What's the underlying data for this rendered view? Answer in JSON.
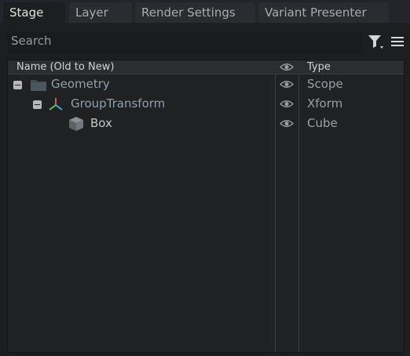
{
  "tabs": [
    {
      "label": "Stage",
      "active": true
    },
    {
      "label": "Layer",
      "active": false
    },
    {
      "label": "Render Settings",
      "active": false
    },
    {
      "label": "Variant Presenter",
      "active": false
    }
  ],
  "search": {
    "placeholder": "Search"
  },
  "toolbar": {
    "filter_icon": "filter-icon",
    "menu_icon": "hamburger-menu-icon"
  },
  "columns": {
    "name": "Name (Old to New)",
    "visibility_icon": "eye-icon",
    "type": "Type"
  },
  "rows": [
    {
      "name": "Geometry",
      "type": "Scope",
      "icon": "folder-icon",
      "depth": 0,
      "expanded": true,
      "name_color": "#8fa0ae"
    },
    {
      "name": "GroupTransform",
      "type": "Xform",
      "icon": "xform-icon",
      "depth": 1,
      "expanded": true,
      "name_color": "#8fa0ae"
    },
    {
      "name": "Box",
      "type": "Cube",
      "icon": "cube-icon",
      "depth": 2,
      "expanded": null,
      "name_color": "#c9c9c9"
    }
  ],
  "colors": {
    "background": "#1d1e1f",
    "active_tab": "#1d1e1f",
    "inactive_tab": "#2a2c30"
  }
}
